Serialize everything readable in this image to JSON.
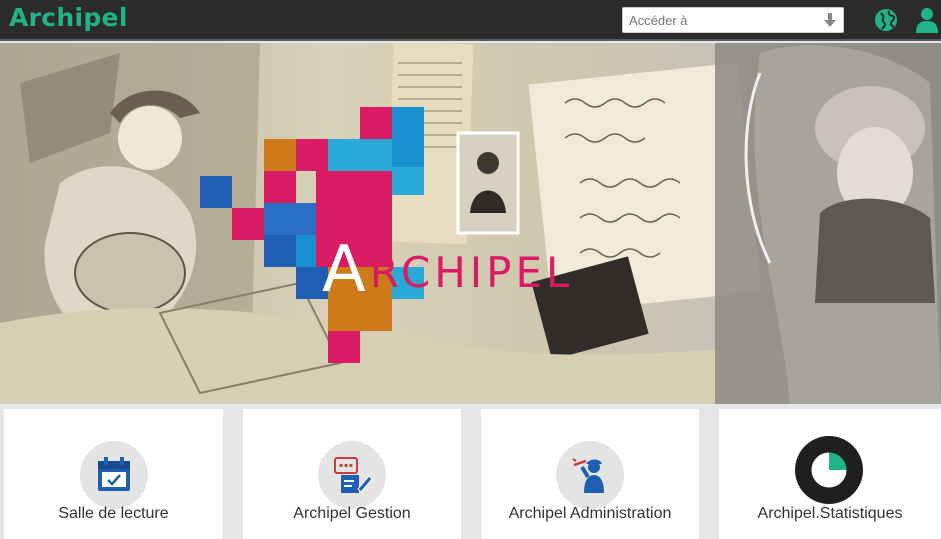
{
  "header": {
    "brand": "Archipel",
    "search_placeholder": "Accéder à",
    "globe_icon": "globe-icon",
    "user_icon": "user-icon",
    "accent_color": "#20b38a"
  },
  "banner": {
    "logo_initial": "A",
    "logo_rest": "RCHIPEL",
    "logo_color": "#d81b63"
  },
  "tiles": [
    {
      "label": "Salle de lecture",
      "icon": "calendar-icon"
    },
    {
      "label": "Archipel Gestion",
      "icon": "chat-edit-icon"
    },
    {
      "label": "Archipel Administration",
      "icon": "statue-icon"
    },
    {
      "label": "Archipel.Statistiques",
      "icon": "pie-chart-icon"
    }
  ]
}
